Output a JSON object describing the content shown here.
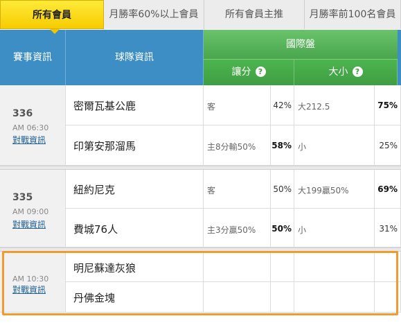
{
  "tabs": [
    {
      "label": "所有會員",
      "active": true
    },
    {
      "label": "月勝率60%以上會員",
      "active": false
    },
    {
      "label": "所有會員主推",
      "active": false
    },
    {
      "label": "月勝率前100名會員",
      "active": false
    }
  ],
  "header": {
    "event_info": "賽事資訊",
    "team_info": "球隊資訊",
    "international": "國際盤",
    "spread": "讓分",
    "total": "大小",
    "help_glyph": "?"
  },
  "games": [
    {
      "number": "336",
      "time": "AM 06:30",
      "link": "對戰資訊",
      "teams": [
        {
          "name": "密爾瓦基公鹿",
          "spread": "客",
          "spread_pct": "42%",
          "total": "大212.5",
          "total_pct": "75%"
        },
        {
          "name": "印第安那溜馬",
          "spread": "主8分輸50%",
          "spread_pct": "58%",
          "total": "小",
          "total_pct": "25%"
        }
      ]
    },
    {
      "number": "335",
      "time": "AM 09:00",
      "link": "對戰資訊",
      "teams": [
        {
          "name": "紐約尼克",
          "spread": "客",
          "spread_pct": "50%",
          "total": "大199贏50%",
          "total_pct": "69%"
        },
        {
          "name": "費城76人",
          "spread": "主3分贏50%",
          "spread_pct": "50%",
          "total": "小",
          "total_pct": "31%"
        }
      ]
    },
    {
      "number": "",
      "time": "AM 10:30",
      "link": "對戰資訊",
      "teams": [
        {
          "name": "明尼蘇達灰狼",
          "spread": "",
          "spread_pct": "",
          "total": "",
          "total_pct": ""
        },
        {
          "name": "丹佛金塊",
          "spread": "",
          "spread_pct": "",
          "total": "",
          "total_pct": ""
        }
      ]
    }
  ],
  "colors": {
    "active_tab": "#f6cc00",
    "header_blue": "#3d8ec5",
    "header_green": "#4aa64c",
    "highlight": "#f39a2e",
    "link": "#1f5f95"
  }
}
